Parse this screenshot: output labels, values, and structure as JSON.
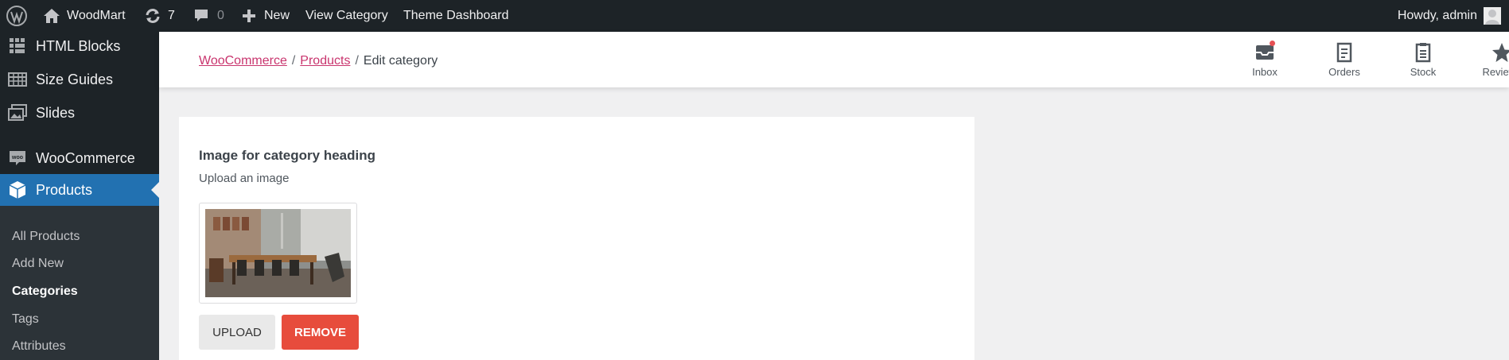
{
  "admin_bar": {
    "site_name": "WoodMart",
    "updates_count": "7",
    "comments_count": "0",
    "new_label": "New",
    "view_category": "View Category",
    "theme_dashboard": "Theme Dashboard",
    "greeting": "Howdy, admin"
  },
  "sidebar": {
    "items": [
      {
        "label": "HTML Blocks",
        "icon": "blocks-grid-icon"
      },
      {
        "label": "Size Guides",
        "icon": "ruler-table-icon"
      },
      {
        "label": "Slides",
        "icon": "slides-images-icon"
      },
      {
        "label": "WooCommerce",
        "icon": "woocommerce-bubble-icon"
      },
      {
        "label": "Products",
        "icon": "product-box-icon"
      }
    ],
    "submenu": [
      {
        "label": "All Products"
      },
      {
        "label": "Add New"
      },
      {
        "label": "Categories",
        "current": true
      },
      {
        "label": "Tags"
      },
      {
        "label": "Attributes"
      }
    ]
  },
  "header": {
    "breadcrumb": [
      "WooCommerce",
      "Products",
      "Edit category"
    ],
    "buttons": [
      {
        "label": "Inbox",
        "icon": "inbox-icon",
        "has_notification": true
      },
      {
        "label": "Orders",
        "icon": "orders-clipboard-icon"
      },
      {
        "label": "Stock",
        "icon": "stock-clipboard-icon"
      },
      {
        "label": "Reviews",
        "icon": "star-icon"
      }
    ]
  },
  "form": {
    "title": "Image for category heading",
    "help": "Upload an image",
    "upload_label": "UPLOAD",
    "remove_label": "REMOVE"
  },
  "colors": {
    "admin_bar_bg": "#1d2327",
    "sidebar_active": "#2271b1",
    "link_accent": "#c9356e",
    "remove_button": "#e74c3c",
    "notification_dot": "#e65054"
  }
}
